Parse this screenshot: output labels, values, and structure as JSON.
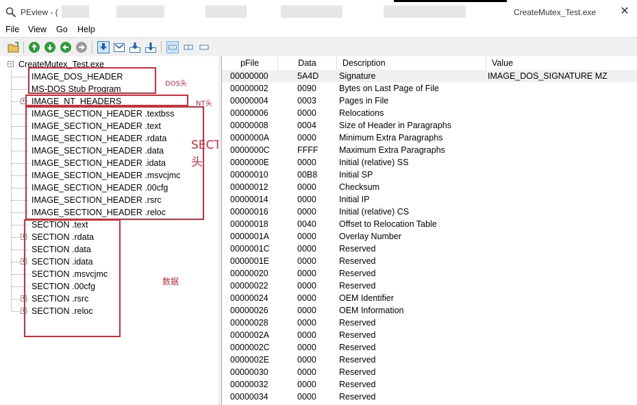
{
  "window": {
    "app_name": "PEview - (",
    "file_name": "CreateMutex_Test.exe",
    "close_label": "✕"
  },
  "menu": [
    "File",
    "View",
    "Go",
    "Help"
  ],
  "toolbar": {
    "buttons": [
      "open-icon",
      "back-icon",
      "forward-icon",
      "up-icon",
      "down-icon",
      "view-hex-icon",
      "view-header-icon",
      "view-import-icon",
      "view-export-icon",
      "mode-list-icon",
      "mode-detail-icon",
      "mode-compact-icon"
    ]
  },
  "tree": {
    "root": "CreateMutex_Test.exe",
    "items": [
      {
        "label": "IMAGE_DOS_HEADER",
        "expandable": false
      },
      {
        "label": "MS-DOS Stub Program",
        "expandable": false
      },
      {
        "label": "IMAGE_NT_HEADERS",
        "expandable": true
      },
      {
        "label": "IMAGE_SECTION_HEADER .textbss",
        "expandable": false
      },
      {
        "label": "IMAGE_SECTION_HEADER .text",
        "expandable": false
      },
      {
        "label": "IMAGE_SECTION_HEADER .rdata",
        "expandable": false
      },
      {
        "label": "IMAGE_SECTION_HEADER .data",
        "expandable": false
      },
      {
        "label": "IMAGE_SECTION_HEADER .idata",
        "expandable": false
      },
      {
        "label": "IMAGE_SECTION_HEADER .msvcjmc",
        "expandable": false
      },
      {
        "label": "IMAGE_SECTION_HEADER .00cfg",
        "expandable": false
      },
      {
        "label": "IMAGE_SECTION_HEADER .rsrc",
        "expandable": false
      },
      {
        "label": "IMAGE_SECTION_HEADER .reloc",
        "expandable": false
      },
      {
        "label": "SECTION .text",
        "expandable": false
      },
      {
        "label": "SECTION .rdata",
        "expandable": true
      },
      {
        "label": "SECTION .data",
        "expandable": false
      },
      {
        "label": "SECTION .idata",
        "expandable": true
      },
      {
        "label": "SECTION .msvcjmc",
        "expandable": false
      },
      {
        "label": "SECTION .00cfg",
        "expandable": false
      },
      {
        "label": "SECTION .rsrc",
        "expandable": true
      },
      {
        "label": "SECTION .reloc",
        "expandable": true
      }
    ]
  },
  "annotations": {
    "dos": "DOS头",
    "nt": "NT头",
    "section": "SECTION头",
    "data": "数据",
    "color": "#d62a38"
  },
  "grid": {
    "columns": [
      "pFile",
      "Data",
      "Description",
      "Value"
    ],
    "rows": [
      {
        "pfile": "00000000",
        "data": "5A4D",
        "desc": "Signature",
        "value": "IMAGE_DOS_SIGNATURE  MZ"
      },
      {
        "pfile": "00000002",
        "data": "0090",
        "desc": "Bytes on Last Page of File",
        "value": ""
      },
      {
        "pfile": "00000004",
        "data": "0003",
        "desc": "Pages in File",
        "value": ""
      },
      {
        "pfile": "00000006",
        "data": "0000",
        "desc": "Relocations",
        "value": ""
      },
      {
        "pfile": "00000008",
        "data": "0004",
        "desc": "Size of Header in Paragraphs",
        "value": ""
      },
      {
        "pfile": "0000000A",
        "data": "0000",
        "desc": "Minimum Extra Paragraphs",
        "value": ""
      },
      {
        "pfile": "0000000C",
        "data": "FFFF",
        "desc": "Maximum Extra Paragraphs",
        "value": ""
      },
      {
        "pfile": "0000000E",
        "data": "0000",
        "desc": "Initial (relative) SS",
        "value": ""
      },
      {
        "pfile": "00000010",
        "data": "00B8",
        "desc": "Initial SP",
        "value": ""
      },
      {
        "pfile": "00000012",
        "data": "0000",
        "desc": "Checksum",
        "value": ""
      },
      {
        "pfile": "00000014",
        "data": "0000",
        "desc": "Initial IP",
        "value": ""
      },
      {
        "pfile": "00000016",
        "data": "0000",
        "desc": "Initial (relative) CS",
        "value": ""
      },
      {
        "pfile": "00000018",
        "data": "0040",
        "desc": "Offset to Relocation Table",
        "value": ""
      },
      {
        "pfile": "0000001A",
        "data": "0000",
        "desc": "Overlay Number",
        "value": ""
      },
      {
        "pfile": "0000001C",
        "data": "0000",
        "desc": "Reserved",
        "value": ""
      },
      {
        "pfile": "0000001E",
        "data": "0000",
        "desc": "Reserved",
        "value": ""
      },
      {
        "pfile": "00000020",
        "data": "0000",
        "desc": "Reserved",
        "value": ""
      },
      {
        "pfile": "00000022",
        "data": "0000",
        "desc": "Reserved",
        "value": ""
      },
      {
        "pfile": "00000024",
        "data": "0000",
        "desc": "OEM Identifier",
        "value": ""
      },
      {
        "pfile": "00000026",
        "data": "0000",
        "desc": "OEM Information",
        "value": ""
      },
      {
        "pfile": "00000028",
        "data": "0000",
        "desc": "Reserved",
        "value": ""
      },
      {
        "pfile": "0000002A",
        "data": "0000",
        "desc": "Reserved",
        "value": ""
      },
      {
        "pfile": "0000002C",
        "data": "0000",
        "desc": "Reserved",
        "value": ""
      },
      {
        "pfile": "0000002E",
        "data": "0000",
        "desc": "Reserved",
        "value": ""
      },
      {
        "pfile": "00000030",
        "data": "0000",
        "desc": "Reserved",
        "value": ""
      },
      {
        "pfile": "00000032",
        "data": "0000",
        "desc": "Reserved",
        "value": ""
      },
      {
        "pfile": "00000034",
        "data": "0000",
        "desc": "Reserved",
        "value": ""
      }
    ]
  }
}
